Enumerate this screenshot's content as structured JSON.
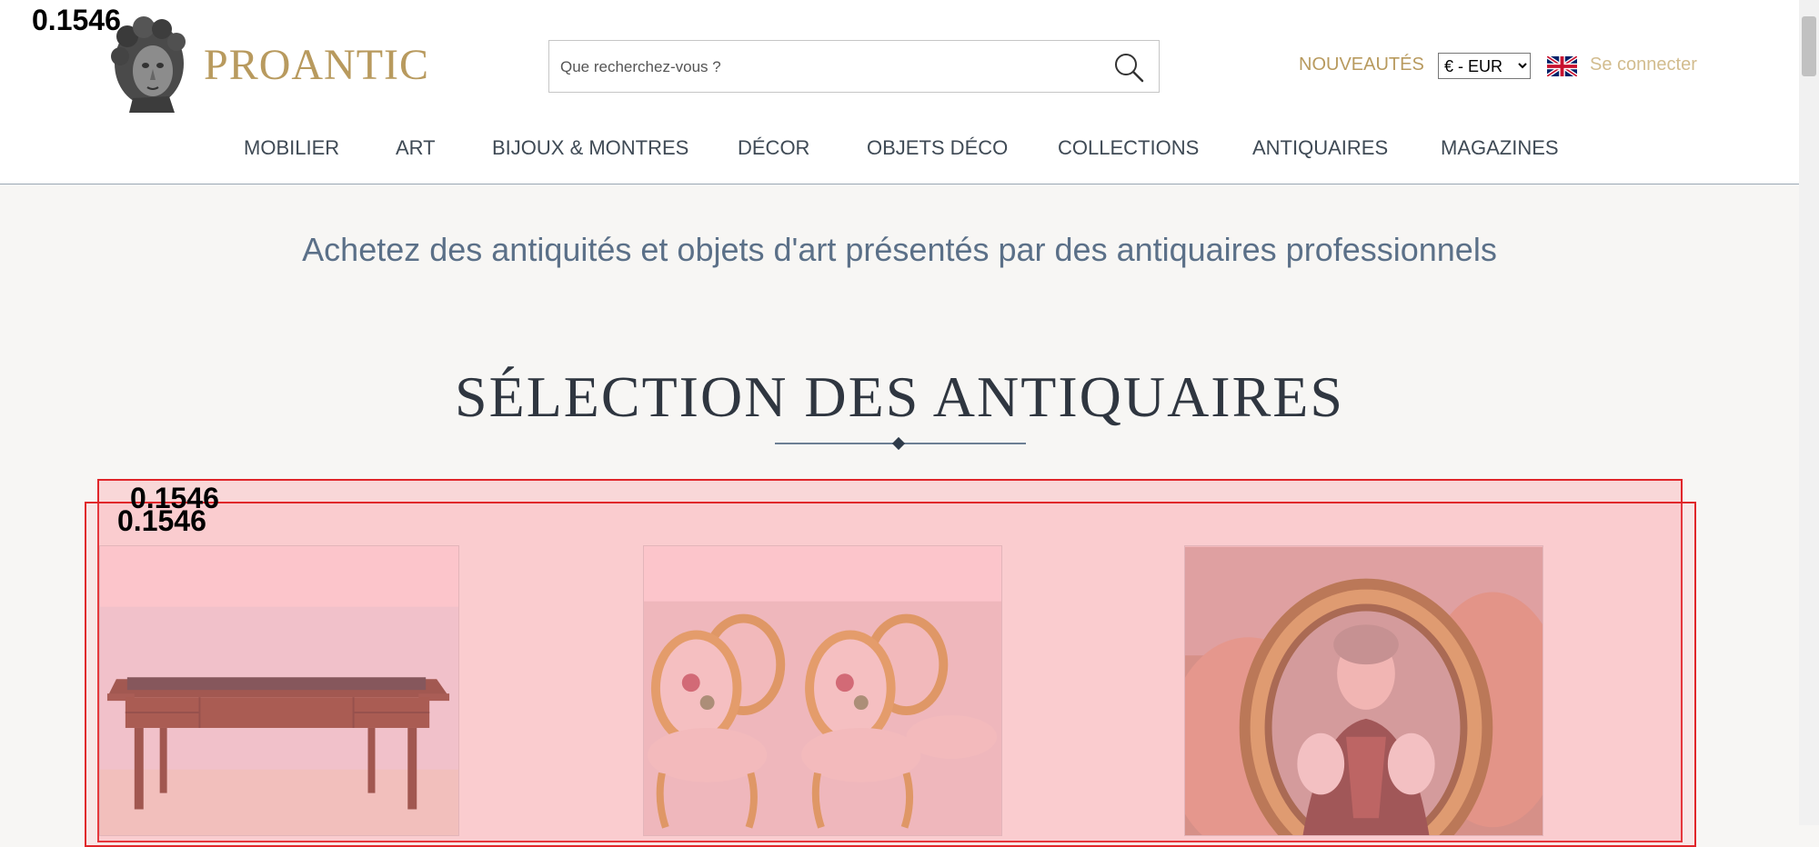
{
  "header": {
    "logo_text": "PROANTIC",
    "search": {
      "placeholder": "Que recherchez-vous ?",
      "value": ""
    },
    "new_label": "NOUVEAUTÉS",
    "currency": {
      "selected": "€ - EUR",
      "options": [
        "€ - EUR"
      ]
    },
    "language_flag": "uk-flag-icon",
    "login_label": "Se connecter"
  },
  "nav": {
    "items": [
      {
        "label": "MOBILIER"
      },
      {
        "label": "ART"
      },
      {
        "label": "BIJOUX & MONTRES"
      },
      {
        "label": "DÉCOR"
      },
      {
        "label": "OBJETS DÉCO"
      },
      {
        "label": "COLLECTIONS"
      },
      {
        "label": "ANTIQUAIRES"
      },
      {
        "label": "MAGAZINES"
      }
    ]
  },
  "main": {
    "tagline": "Achetez des antiquités et objets d'art présentés par des antiquaires professionnels",
    "section_title": "SÉLECTION DES ANTIQUAIRES",
    "cards": [
      {
        "icon": "desk-photo"
      },
      {
        "icon": "armchairs-photo"
      },
      {
        "icon": "miniature-portrait-photo"
      }
    ]
  },
  "overlays": {
    "header_score": "0.1546",
    "outer_score": "0.1546",
    "inner_score": "0.1546"
  },
  "colors": {
    "brand_gold": "#b89a5e",
    "nav_text": "#3f4a55",
    "tagline": "#5b7088",
    "overlay_border": "#e0262a"
  }
}
